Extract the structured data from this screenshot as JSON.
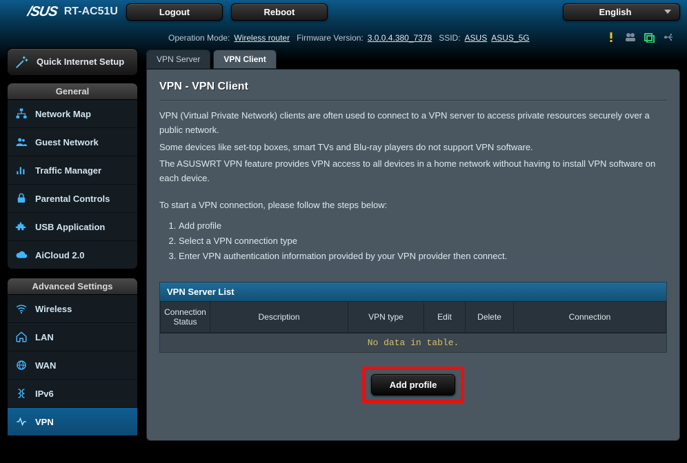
{
  "brand": {
    "logo": "/SUS",
    "model": "RT-AC51U"
  },
  "top_buttons": {
    "logout": "Logout",
    "reboot": "Reboot",
    "language": "English"
  },
  "status": {
    "opmode_label": "Operation Mode:",
    "opmode_value": "Wireless router",
    "fw_label": "Firmware Version:",
    "fw_value": "3.0.0.4.380_7378",
    "ssid_label": "SSID:",
    "ssid1": "ASUS",
    "ssid2": "ASUS_5G"
  },
  "sidebar": {
    "quick_setup": "Quick Internet Setup",
    "general_title": "General",
    "general": [
      {
        "label": "Network Map"
      },
      {
        "label": "Guest Network"
      },
      {
        "label": "Traffic Manager"
      },
      {
        "label": "Parental Controls"
      },
      {
        "label": "USB Application"
      },
      {
        "label": "AiCloud 2.0"
      }
    ],
    "advanced_title": "Advanced Settings",
    "advanced": [
      {
        "label": "Wireless"
      },
      {
        "label": "LAN"
      },
      {
        "label": "WAN"
      },
      {
        "label": "IPv6"
      },
      {
        "label": "VPN"
      }
    ]
  },
  "tabs": {
    "server": "VPN Server",
    "client": "VPN Client"
  },
  "panel": {
    "title": "VPN - VPN Client",
    "p1": "VPN (Virtual Private Network) clients are often used to connect to a VPN server to access private resources securely over a public network.",
    "p2": "Some devices like set-top boxes, smart TVs and Blu-ray players do not support VPN software.",
    "p3": "The ASUSWRT VPN feature provides VPN access to all devices in a home network without having to install VPN software on each device.",
    "steps_intro": "To start a VPN connection, please follow the steps below:",
    "steps": [
      "Add profile",
      "Select a VPN connection type",
      "Enter VPN authentication information provided by your VPN provider then connect."
    ]
  },
  "table": {
    "title": "VPN Server List",
    "headers": [
      "Connection Status",
      "Description",
      "VPN type",
      "Edit",
      "Delete",
      "Connection"
    ],
    "empty": "No data in table."
  },
  "addprofile": "Add profile"
}
